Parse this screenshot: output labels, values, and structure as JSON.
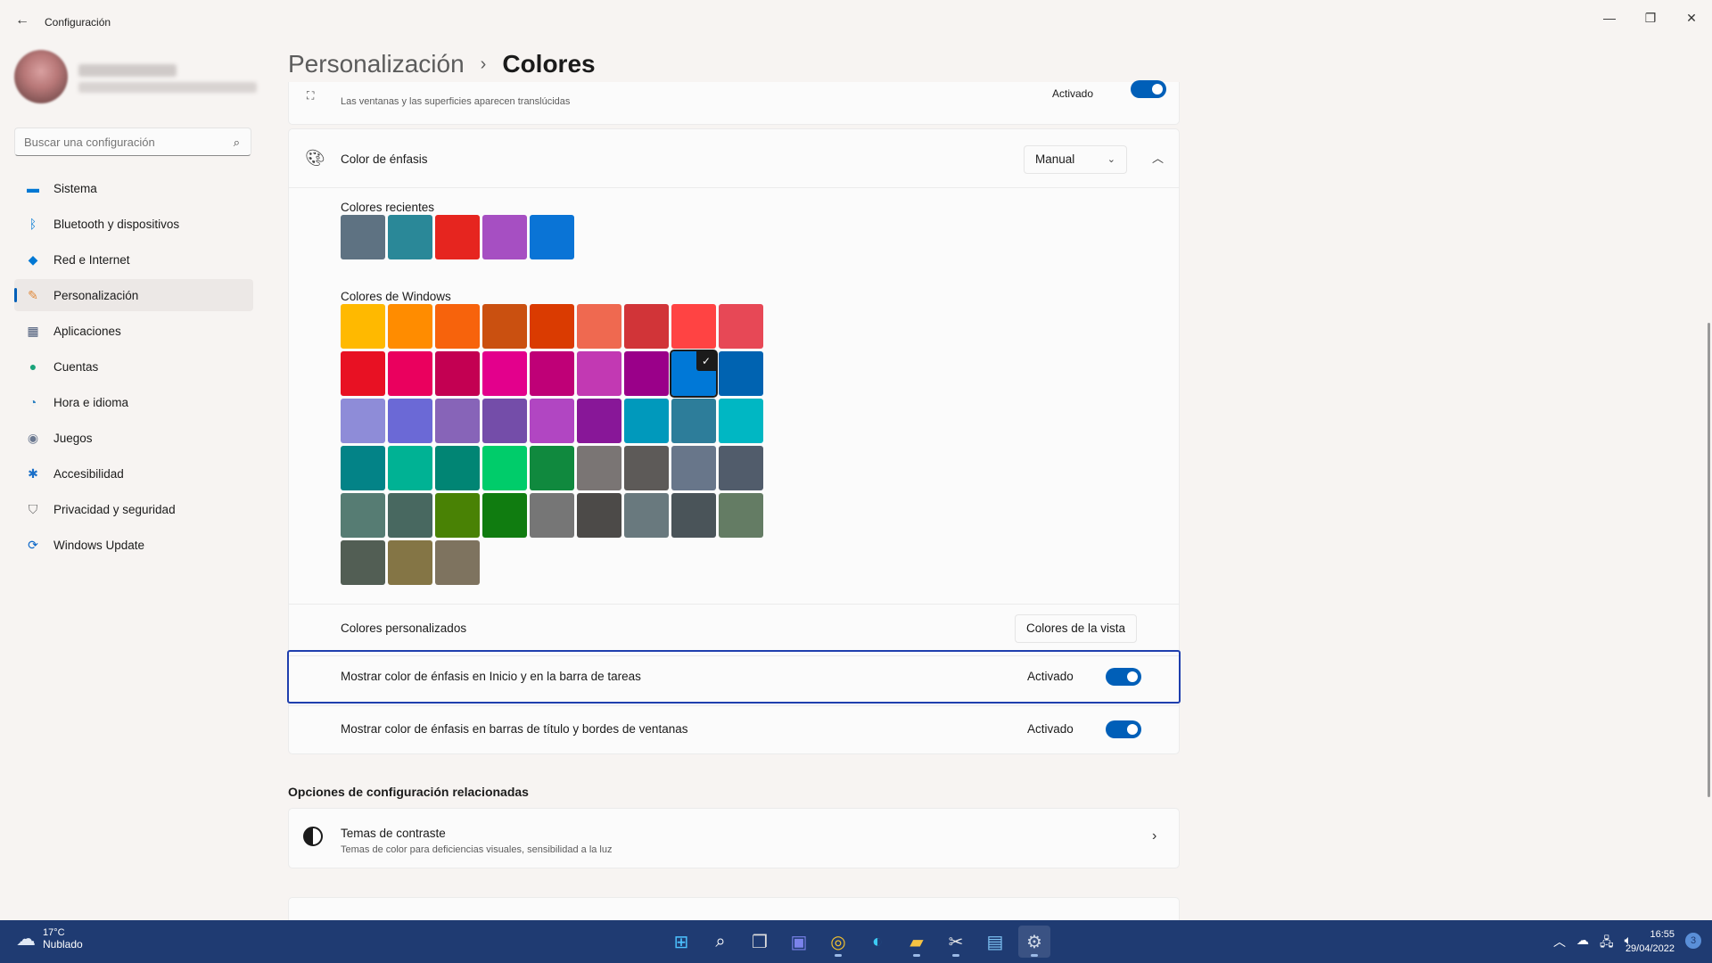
{
  "app": {
    "title": "Configuración"
  },
  "window_controls": {
    "minimize": "—",
    "maximize": "❐",
    "close": "✕"
  },
  "profile": {
    "name": "",
    "email": ""
  },
  "search": {
    "placeholder": "Buscar una configuración"
  },
  "sidebar": {
    "items": [
      {
        "label": "Sistema",
        "icon": "monitor-icon",
        "color": "#0078d4",
        "active": false
      },
      {
        "label": "Bluetooth y dispositivos",
        "icon": "bluetooth-icon",
        "color": "#0078d4",
        "active": false
      },
      {
        "label": "Red e Internet",
        "icon": "wifi-icon",
        "color": "#0078d4",
        "active": false
      },
      {
        "label": "Personalización",
        "icon": "brush-icon",
        "color": "#e08a3c",
        "active": true
      },
      {
        "label": "Aplicaciones",
        "icon": "apps-icon",
        "color": "#4a5a78",
        "active": false
      },
      {
        "label": "Cuentas",
        "icon": "person-icon",
        "color": "#1aa37a",
        "active": false
      },
      {
        "label": "Hora e idioma",
        "icon": "globe-clock-icon",
        "color": "#2a7fc0",
        "active": false
      },
      {
        "label": "Juegos",
        "icon": "gamepad-icon",
        "color": "#6b7890",
        "active": false
      },
      {
        "label": "Accesibilidad",
        "icon": "accessibility-icon",
        "color": "#1a6fc8",
        "active": false
      },
      {
        "label": "Privacidad y seguridad",
        "icon": "shield-icon",
        "color": "#6b6b6b",
        "active": false
      },
      {
        "label": "Windows Update",
        "icon": "update-icon",
        "color": "#0a66c8",
        "active": false
      }
    ]
  },
  "breadcrumb": {
    "parent": "Personalización",
    "separator": "›",
    "current": "Colores"
  },
  "transparency": {
    "description": "Las ventanas y las superficies aparecen translúcidas",
    "state": "Activado",
    "on": true
  },
  "accent": {
    "label": "Color de énfasis",
    "mode": "Manual",
    "recent_label": "Colores recientes",
    "recent_colors": [
      "#5e7282",
      "#2a8898",
      "#e6251f",
      "#a64fc2",
      "#0a74d6"
    ],
    "windows_label": "Colores de Windows",
    "windows_colors": [
      [
        "#ffb900",
        "#ff8c00",
        "#f7630c",
        "#ca5010",
        "#da3b01",
        "#ef6950",
        "#d13438",
        "#ff4343",
        "#e74856"
      ],
      [
        "#e81123",
        "#ea005e",
        "#c30052",
        "#e3008c",
        "#bf0077",
        "#c239b3",
        "#9a0089",
        "#0078d7",
        "#0063b1"
      ],
      [
        "#8e8cd8",
        "#6b69d6",
        "#8764b8",
        "#744da9",
        "#b146c2",
        "#881798",
        "#0099bc",
        "#2d7d9a",
        "#00b7c3"
      ],
      [
        "#038387",
        "#00b294",
        "#018574",
        "#00cc6a",
        "#10893e",
        "#7a7574",
        "#5d5a58",
        "#68768a",
        "#515c6b"
      ],
      [
        "#567c73",
        "#486860",
        "#498205",
        "#107c10",
        "#767676",
        "#4c4a48",
        "#69797e",
        "#4a5459",
        "#647c64"
      ],
      [
        "#525e54",
        "#847545",
        "#7e735f"
      ]
    ],
    "selected": {
      "row": 1,
      "col": 7
    },
    "custom_label": "Colores personalizados",
    "custom_button": "Colores de la vista"
  },
  "show_accent_start": {
    "label": "Mostrar color de énfasis en Inicio y en la barra de tareas",
    "state": "Activado",
    "on": true
  },
  "show_accent_titlebars": {
    "label": "Mostrar color de énfasis en barras de título y bordes de ventanas",
    "state": "Activado",
    "on": true
  },
  "related": {
    "title": "Opciones de configuración relacionadas",
    "contrast_title": "Temas de contraste",
    "contrast_desc": "Temas de color para deficiencias visuales, sensibilidad a la luz"
  },
  "taskbar": {
    "weather_temp": "17°C",
    "weather_desc": "Nublado",
    "time": "16:55",
    "date": "29/04/2022",
    "notifications": "3",
    "apps": [
      "windows-start-icon",
      "search-icon",
      "task-view-icon",
      "teams-chat-icon",
      "chrome-icon",
      "edge-icon",
      "file-explorer-icon",
      "snipping-tool-icon",
      "notepad-icon",
      "settings-icon"
    ]
  }
}
